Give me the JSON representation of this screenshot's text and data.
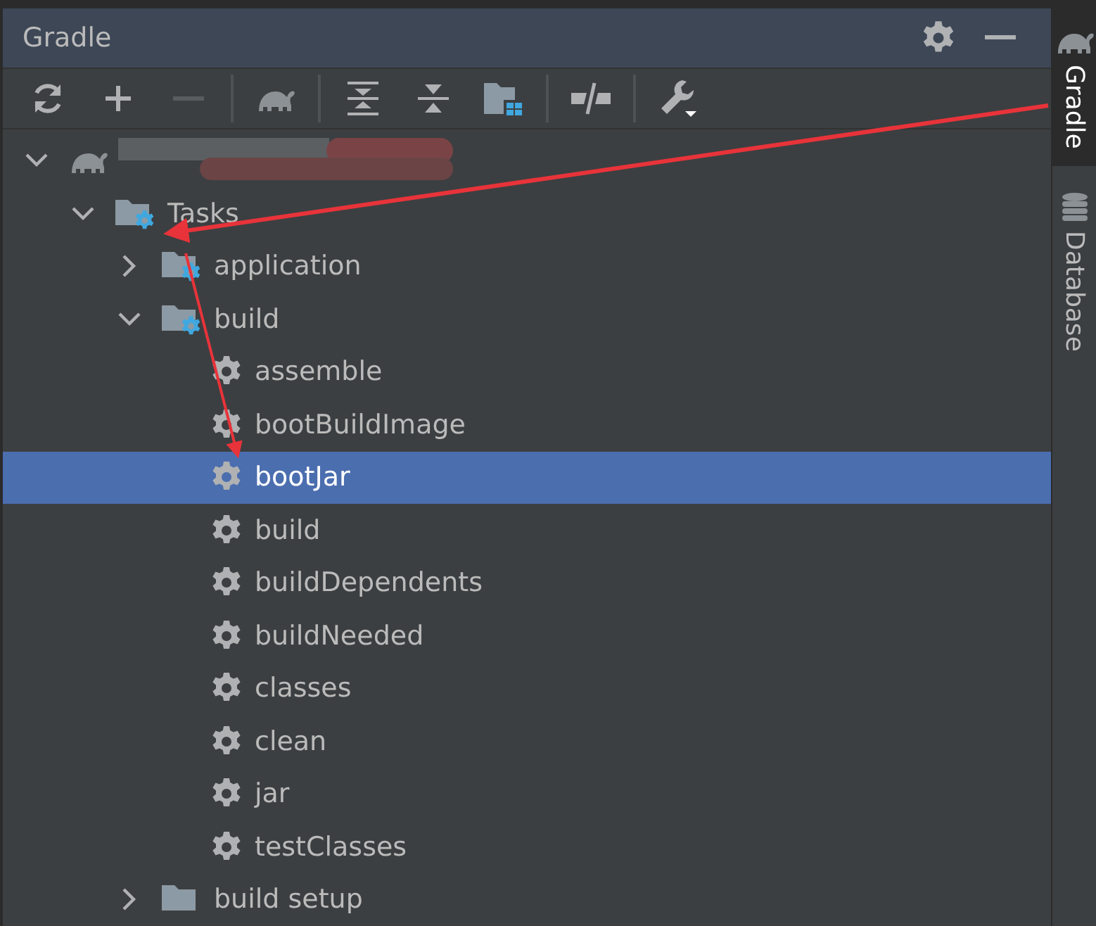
{
  "panel": {
    "title": "Gradle"
  },
  "toolbar": [
    {
      "kind": "refresh"
    },
    {
      "kind": "add"
    },
    {
      "kind": "remove",
      "disabled": true
    },
    {
      "kind": "sep"
    },
    {
      "kind": "elephant"
    },
    {
      "kind": "sep"
    },
    {
      "kind": "expand"
    },
    {
      "kind": "collapse"
    },
    {
      "kind": "folder"
    },
    {
      "kind": "sep"
    },
    {
      "kind": "offline"
    },
    {
      "kind": "sep"
    },
    {
      "kind": "wrench"
    }
  ],
  "tree": [
    {
      "kind": "project",
      "expanded": true,
      "selected": false,
      "children": [
        {
          "kind": "folder",
          "label": "Tasks",
          "expanded": true,
          "selected": false,
          "children": [
            {
              "kind": "folder",
              "label": "application",
              "expanded": false,
              "selected": false
            },
            {
              "kind": "folder",
              "label": "build",
              "expanded": true,
              "selected": false,
              "children": [
                {
                  "kind": "task",
                  "label": "assemble",
                  "selected": false
                },
                {
                  "kind": "task",
                  "label": "bootBuildImage",
                  "selected": false
                },
                {
                  "kind": "task",
                  "label": "bootJar",
                  "selected": true
                },
                {
                  "kind": "task",
                  "label": "build",
                  "selected": false
                },
                {
                  "kind": "task",
                  "label": "buildDependents",
                  "selected": false
                },
                {
                  "kind": "task",
                  "label": "buildNeeded",
                  "selected": false
                },
                {
                  "kind": "task",
                  "label": "classes",
                  "selected": false
                },
                {
                  "kind": "task",
                  "label": "clean",
                  "selected": false
                },
                {
                  "kind": "task",
                  "label": "jar",
                  "selected": false
                },
                {
                  "kind": "task",
                  "label": "testClasses",
                  "selected": false
                }
              ]
            },
            {
              "kind": "plainfolder",
              "label": "build setup",
              "expanded": false,
              "selected": false
            }
          ]
        }
      ]
    }
  ],
  "side_tabs": [
    {
      "label": "Gradle",
      "kind": "gradle",
      "selected": true
    },
    {
      "label": "Database",
      "kind": "database",
      "selected": false
    }
  ]
}
